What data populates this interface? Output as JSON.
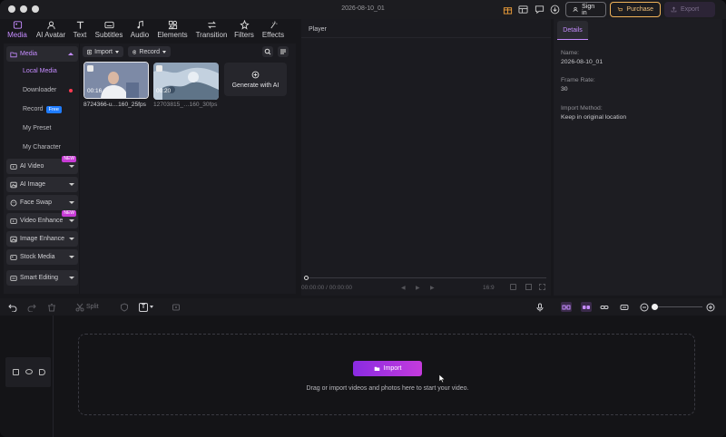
{
  "window": {
    "title": "2026-08-10_01"
  },
  "titlebar": {
    "sign_in": "Sign in",
    "purchase": "Purchase",
    "export": "Export"
  },
  "tooltabs": [
    {
      "label": "Media",
      "icon": "media-icon",
      "active": true
    },
    {
      "label": "AI Avatar",
      "icon": "avatar-icon"
    },
    {
      "label": "Text",
      "icon": "text-icon"
    },
    {
      "label": "Subtitles",
      "icon": "subtitles-icon"
    },
    {
      "label": "Audio",
      "icon": "audio-icon"
    },
    {
      "label": "Elements",
      "icon": "elements-icon"
    },
    {
      "label": "Transition",
      "icon": "transition-icon"
    },
    {
      "label": "Filters",
      "icon": "filters-icon"
    },
    {
      "label": "Effects",
      "icon": "effects-icon"
    }
  ],
  "sidebar": {
    "media": "Media",
    "local_media": "Local Media",
    "downloader": "Downloader",
    "record": "Record",
    "free_badge": "Free",
    "my_preset": "My Preset",
    "my_character": "My Character",
    "ai_video": "AI Video",
    "ai_image": "AI Image",
    "face_swap": "Face Swap",
    "video_enhance": "Video Enhance",
    "image_enhance": "Image Enhance",
    "stock_media": "Stock Media",
    "smart_editing": "Smart Editing",
    "new_badge": "NEW"
  },
  "media_panel": {
    "import_label": "Import",
    "record_label": "Record",
    "items": [
      {
        "name": "8724366-u…160_25fps",
        "duration": "00:16",
        "selected": true
      },
      {
        "name": "12703815_…160_30fps",
        "duration": "00:20",
        "selected": false
      }
    ],
    "generate_ai": "Generate with AI"
  },
  "player": {
    "title": "Player",
    "current_time": "00:00:00",
    "separator": "/",
    "total_time": "00:00:00",
    "aspect": "16:9"
  },
  "details": {
    "tab": "Details",
    "name_label": "Name:",
    "name_value": "2026-08-10_01",
    "frame_rate_label": "Frame Rate:",
    "frame_rate_value": "30",
    "import_method_label": "Import Method:",
    "import_method_value": "Keep in original location"
  },
  "timeline": {
    "split_label": "Split",
    "text_tool": "T",
    "import_button": "Import",
    "drop_hint": "Drag or import videos and photos here to start your video."
  },
  "colors": {
    "accent": "#c58cff",
    "purchase": "#f0b35a",
    "import_gradient_start": "#8a2be2",
    "import_gradient_end": "#c43bdc"
  }
}
